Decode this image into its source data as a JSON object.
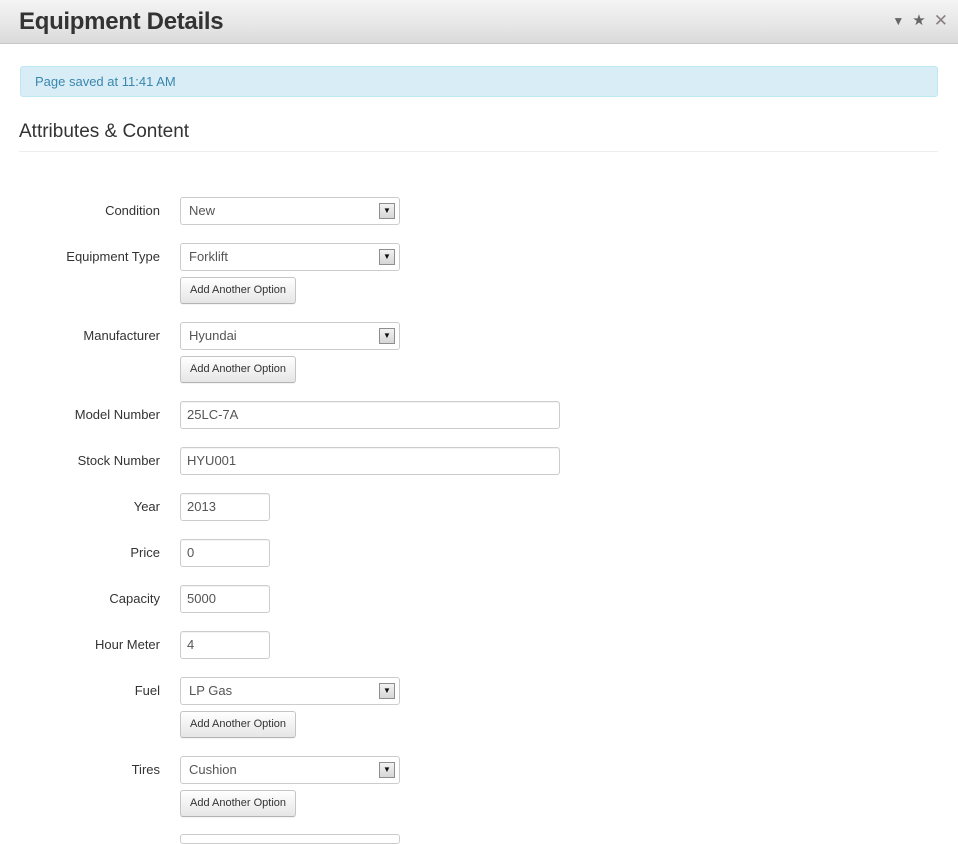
{
  "window": {
    "title": "Equipment Details",
    "controls": [
      {
        "name": "collapse",
        "icon": "triangle-down-icon",
        "glyph": "▼"
      },
      {
        "name": "favorite",
        "icon": "star-icon",
        "glyph": "★"
      },
      {
        "name": "close",
        "icon": "close-icon",
        "glyph": "✕"
      }
    ]
  },
  "alert": {
    "message": "Page saved at 11:41 AM"
  },
  "section": {
    "title": "Attributes & Content"
  },
  "add_option_label": "Add Another Option",
  "dropdown_arrow_glyph": "▼",
  "fields": {
    "condition": {
      "label": "Condition",
      "value": "New"
    },
    "equipment_type": {
      "label": "Equipment Type",
      "value": "Forklift"
    },
    "manufacturer": {
      "label": "Manufacturer",
      "value": "Hyundai"
    },
    "model_number": {
      "label": "Model Number",
      "value": "25LC-7A"
    },
    "stock_number": {
      "label": "Stock Number",
      "value": "HYU001"
    },
    "year": {
      "label": "Year",
      "value": "2013"
    },
    "price": {
      "label": "Price",
      "value": "0"
    },
    "capacity": {
      "label": "Capacity",
      "value": "5000"
    },
    "hour_meter": {
      "label": "Hour Meter",
      "value": "4"
    },
    "fuel": {
      "label": "Fuel",
      "value": "LP Gas"
    },
    "tires": {
      "label": "Tires",
      "value": "Cushion"
    }
  },
  "colors": {
    "alert_bg": "#d9edf7",
    "alert_text": "#3a87ad",
    "alert_border": "#bce8f1"
  }
}
